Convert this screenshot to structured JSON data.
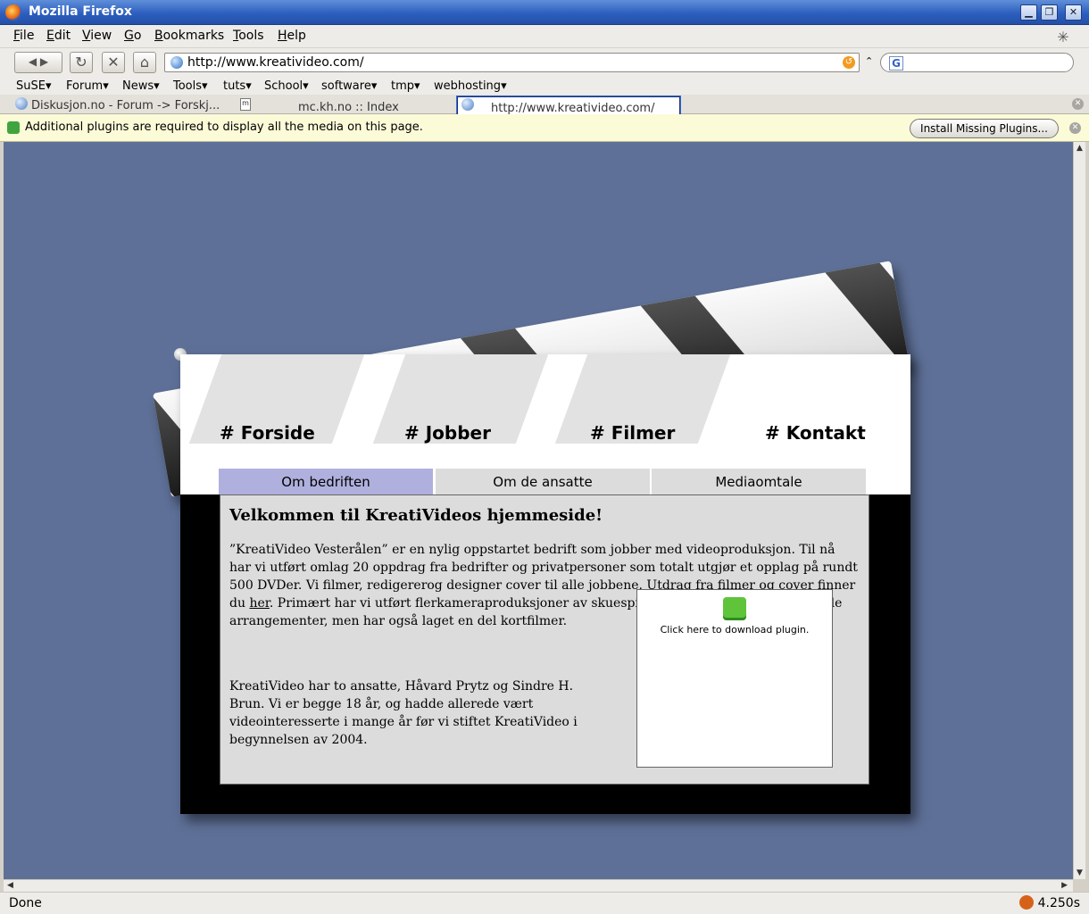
{
  "window": {
    "title": "Mozilla Firefox",
    "buttons": [
      "▁",
      "❐",
      "✕"
    ]
  },
  "menu": [
    "File",
    "Edit",
    "View",
    "Go",
    "Bookmarks",
    "Tools",
    "Help"
  ],
  "nav": {
    "back": "◀ ▶",
    "reload": "↻",
    "stop": "✕",
    "home": "⌂",
    "url": "http://www.kreativideo.com/",
    "go": "↺",
    "arrow": "⌃",
    "search_engine": "G",
    "search_value": ""
  },
  "bookmarks": [
    "SuSE",
    "Forum",
    "News",
    "Tools",
    "tuts",
    "School",
    "software",
    "tmp",
    "webhosting"
  ],
  "tabs": [
    {
      "label": "Diskusjon.no - Forum -> Forskj..."
    },
    {
      "label": "mc.kh.no :: Index"
    },
    {
      "label": "http://www.kreativideo.com/"
    }
  ],
  "plugin_bar": {
    "message": "Additional plugins are required to display all the media on this page.",
    "button": "Install Missing Plugins..."
  },
  "site": {
    "nav": [
      {
        "label": "# Forside"
      },
      {
        "label": "# Jobber"
      },
      {
        "label": "# Filmer"
      },
      {
        "label": "# Kontakt"
      }
    ],
    "subtabs": [
      {
        "label": "Om bedriften"
      },
      {
        "label": "Om de ansatte"
      },
      {
        "label": "Mediaomtale"
      }
    ],
    "heading": "Velkommen til KreatiVideos hjemmeside!",
    "para1_a": "”KreatiVideo Vesterålen” er en nylig oppstartet bedrift som jobber med videoproduksjon. Til nå har vi utført omlag 20 oppdrag fra bedrifter og privatpersoner som totalt utgjør et opplag på rundt 500 DVDer. Vi filmer, redigererog designer cover til alle jobbene. Utdrag fra filmer og cover finner du ",
    "para1_link": "her",
    "para1_b": ". Primært har vi utført flerkameraproduksjoner av skuespill, konserter og andre kulturelle arrangementer, men har også laget en del kortfilmer.",
    "para2": "KreatiVideo har to ansatte, Håvard Prytz og Sindre H. Brun. Vi er begge 18 år, og hadde allerede vært videointeresserte i mange år før vi stiftet KreatiVideo i begynnelsen av 2004.",
    "plugin_text": "Click here to download plugin."
  },
  "status": {
    "text": "Done",
    "time": "4.250s"
  }
}
